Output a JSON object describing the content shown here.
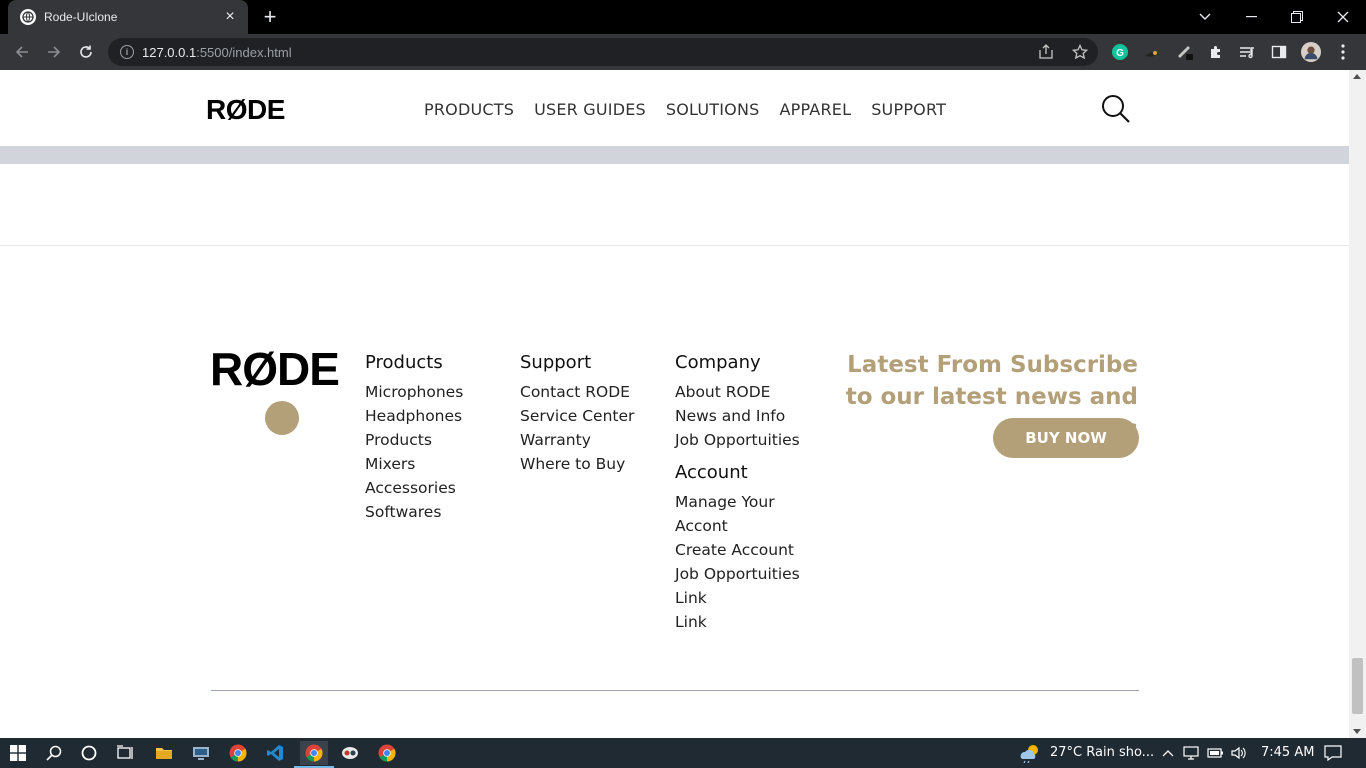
{
  "browser": {
    "tab_title": "Rode-UIclone",
    "url_host": "127.0.0.1",
    "url_rest": ":5500/index.html"
  },
  "site": {
    "logo": "RØDE",
    "nav": [
      "PRODUCTS",
      "USER GUIDES",
      "SOLUTIONS",
      "APPAREL",
      "SUPPORT"
    ]
  },
  "footer": {
    "logo": "RØDE",
    "columns": {
      "products": {
        "title": "Products",
        "links": [
          "Microphones",
          "Headphones",
          "Products",
          "Mixers",
          "Accessories",
          "Softwares"
        ]
      },
      "support": {
        "title": "Support",
        "links": [
          "Contact RODE",
          "Service Center",
          "Warranty",
          "Where to Buy"
        ]
      },
      "company": {
        "title": "Company",
        "links": [
          "About RODE",
          "News and Info",
          "Job Opportuities"
        ]
      },
      "account": {
        "title": "Account",
        "links": [
          "Manage Your",
          "Accont",
          "Create Account",
          "Job Opportuities",
          "Link",
          "Link"
        ]
      }
    },
    "subscribe_text": "Latest From Subscribe to our latest news and offers",
    "buy_now": "BUY NOW"
  },
  "taskbar": {
    "weather": "27°C  Rain sho...",
    "time": "7:45 AM"
  },
  "colors": {
    "accent": "#b39f78",
    "band": "#d1d5db"
  }
}
